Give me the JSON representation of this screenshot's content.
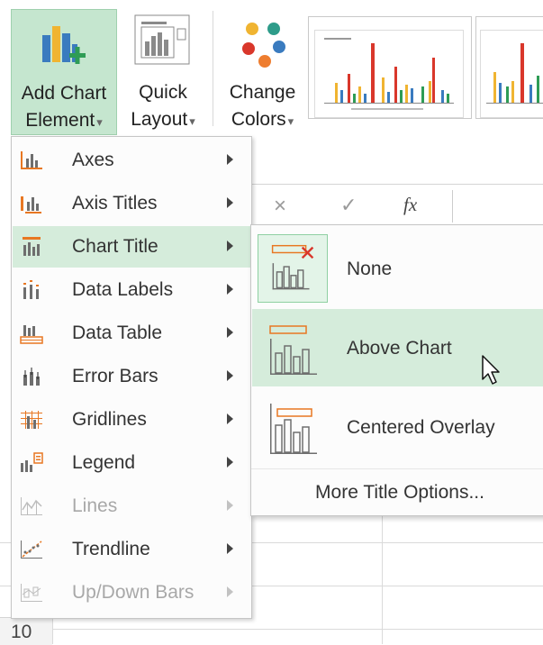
{
  "ribbon": {
    "add_chart_element": {
      "line1": "Add Chart",
      "line2": "Element"
    },
    "quick_layout": {
      "line1": "Quick",
      "line2": "Layout"
    },
    "change_colors": {
      "line1": "Change",
      "line2": "Colors"
    }
  },
  "formula_bar": {
    "cancel_glyph": "×",
    "enter_glyph": "✓",
    "fx_glyph": "fx"
  },
  "menu": {
    "items": [
      {
        "label": "Axes",
        "icon": "axes-icon",
        "disabled": false
      },
      {
        "label": "Axis Titles",
        "icon": "axis-titles-icon",
        "disabled": false
      },
      {
        "label": "Chart Title",
        "icon": "chart-title-icon",
        "disabled": false,
        "active": true
      },
      {
        "label": "Data Labels",
        "icon": "data-labels-icon",
        "disabled": false
      },
      {
        "label": "Data Table",
        "icon": "data-table-icon",
        "disabled": false
      },
      {
        "label": "Error Bars",
        "icon": "error-bars-icon",
        "disabled": false
      },
      {
        "label": "Gridlines",
        "icon": "gridlines-icon",
        "disabled": false
      },
      {
        "label": "Legend",
        "icon": "legend-icon",
        "disabled": false
      },
      {
        "label": "Lines",
        "icon": "lines-icon",
        "disabled": true
      },
      {
        "label": "Trendline",
        "icon": "trendline-icon",
        "disabled": false
      },
      {
        "label": "Up/Down Bars",
        "icon": "up-down-bars-icon",
        "disabled": true
      }
    ]
  },
  "submenu": {
    "items": [
      {
        "label": "None",
        "icon": "no-title-icon"
      },
      {
        "label": "Above Chart",
        "icon": "title-above-chart-icon"
      },
      {
        "label": "Centered Overlay",
        "icon": "centered-overlay-title-icon"
      }
    ],
    "more": "More Title Options..."
  },
  "row_header": {
    "label": "10"
  },
  "colors": {
    "accent_green": "#c5e6cf",
    "hover_green": "#d5ecdb",
    "icon_orange": "#e87722"
  }
}
